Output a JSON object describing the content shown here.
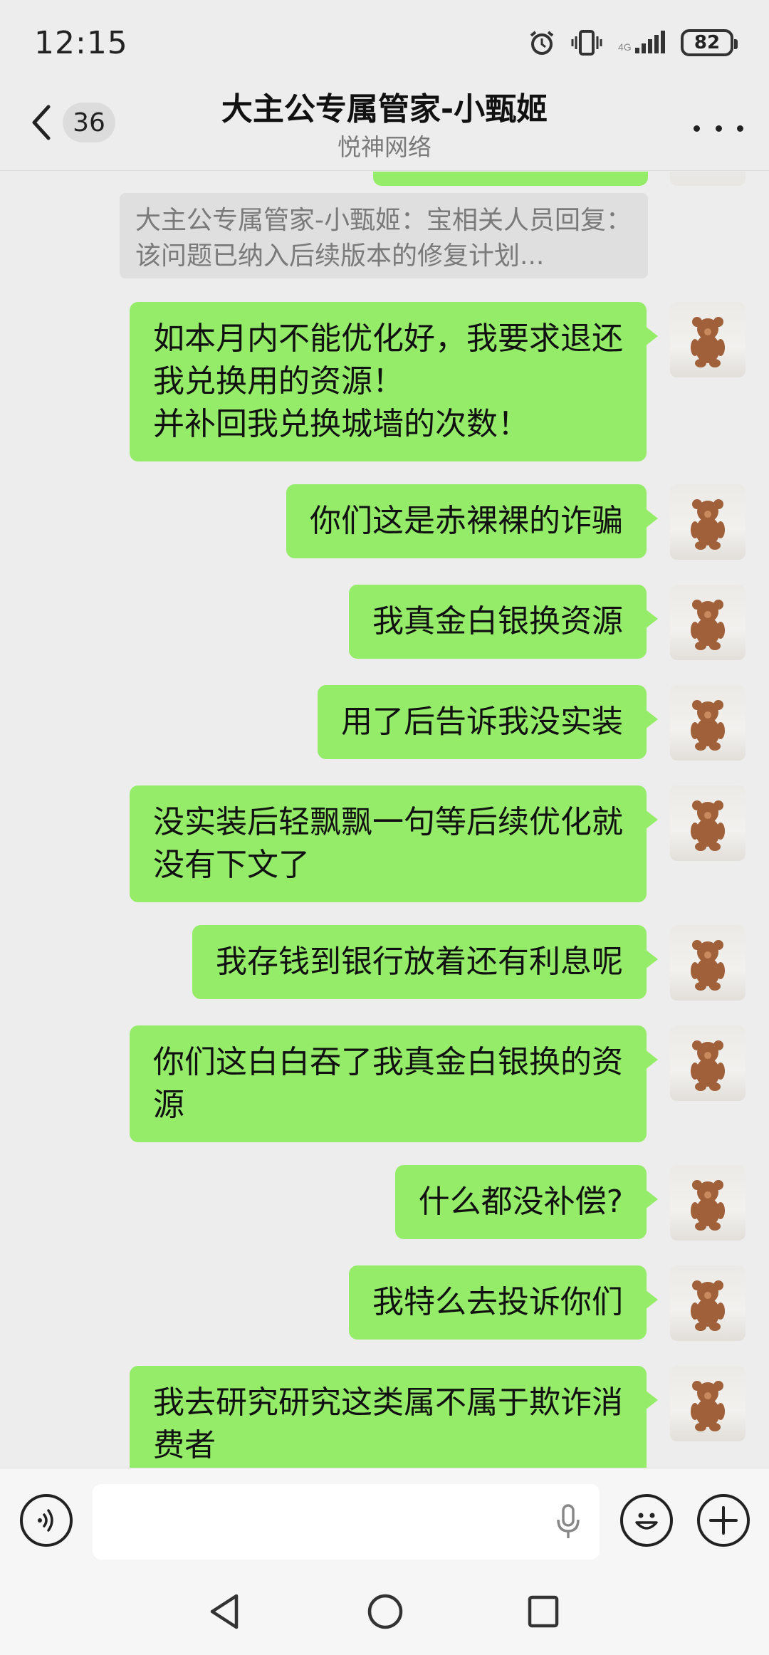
{
  "status_bar": {
    "time": "12:15",
    "battery": "82"
  },
  "header": {
    "unread_count": "36",
    "title": "大主公专属管家-小甄姬",
    "subtitle": "悦神网络"
  },
  "quote": {
    "text": "大主公专属管家-小甄姬：宝相关人员回复：该问题已纳入后续版本的修复计划..."
  },
  "messages": [
    {
      "text": "如本月内不能优化好，我要求退还\n我兑换用的资源！\n并补回我兑换城墙的次数！"
    },
    {
      "text": "你们这是赤裸裸的诈骗"
    },
    {
      "text": "我真金白银换资源"
    },
    {
      "text": "用了后告诉我没实装"
    },
    {
      "text": "没实装后轻飘飘一句等后续优化就\n没有下文了"
    },
    {
      "text": "我存钱到银行放着还有利息呢"
    },
    {
      "text": "你们这白白吞了我真金白银换的资\n源"
    },
    {
      "text": "什么都没补偿?"
    },
    {
      "text": "我特么去投诉你们"
    },
    {
      "text": "我去研究研究这类属不属于欺诈消\n费者"
    }
  ],
  "colors": {
    "bubble_green": "#95ec69",
    "background": "#ededed",
    "quote_bg": "#dfdfdf"
  },
  "icons": [
    "back-arrow-icon",
    "more-icon",
    "voice-icon",
    "microphone-icon",
    "emoji-icon",
    "plus-icon",
    "nav-back-icon",
    "nav-home-icon",
    "nav-recents-icon"
  ]
}
